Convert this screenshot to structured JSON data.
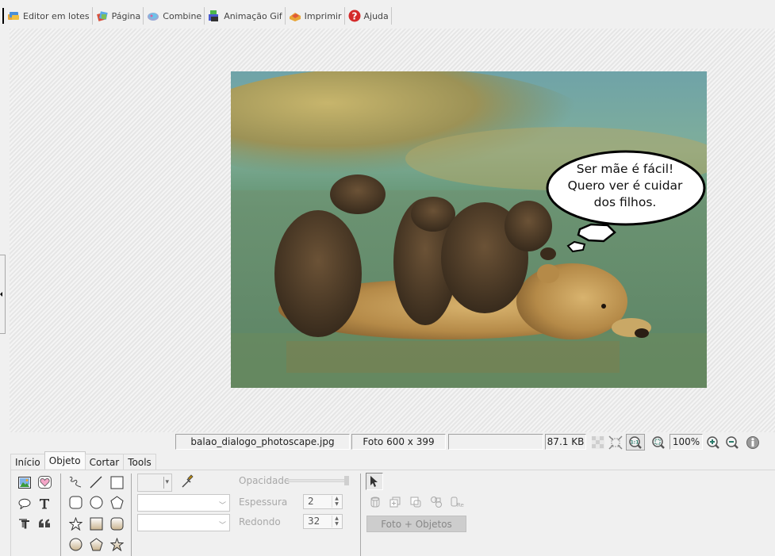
{
  "toolbar": {
    "items": [
      {
        "label": "Editor em lotes",
        "icon": "batch-editor-icon"
      },
      {
        "label": "Página",
        "icon": "page-icon"
      },
      {
        "label": "Combine",
        "icon": "combine-icon"
      },
      {
        "label": "Animação Gif",
        "icon": "gif-animation-icon"
      },
      {
        "label": "Imprimir",
        "icon": "print-icon"
      },
      {
        "label": "Ajuda",
        "icon": "help-icon"
      }
    ]
  },
  "photo": {
    "speech_bubble_text": [
      "Ser mãe é fácil!",
      "Quero ver é cuidar",
      "dos filhos."
    ]
  },
  "status": {
    "filename": "balao_dialogo_photoscape.jpg",
    "dimensions": "Foto 600 x 399",
    "empty_cell": "",
    "filesize": "87.1 KB",
    "zoom": "100%",
    "icons": [
      "transparency-grid-icon",
      "fit-screen-icon",
      "actual-size-icon",
      "zoom-fit-icon",
      "zoom-in-icon",
      "zoom-out-icon",
      "info-icon"
    ]
  },
  "tabs": [
    {
      "label": "Início",
      "active": false
    },
    {
      "label": "Objeto",
      "active": true
    },
    {
      "label": "Cortar",
      "active": false
    },
    {
      "label": "Tools",
      "active": false
    }
  ],
  "object_panel": {
    "opacity_label": "Opacidade",
    "opacity_value": 100,
    "thickness_label": "Espessura",
    "thickness_value": "2",
    "rounding_label": "Redondo",
    "rounding_value": "32",
    "photo_objects_button": "Foto + Objetos"
  }
}
